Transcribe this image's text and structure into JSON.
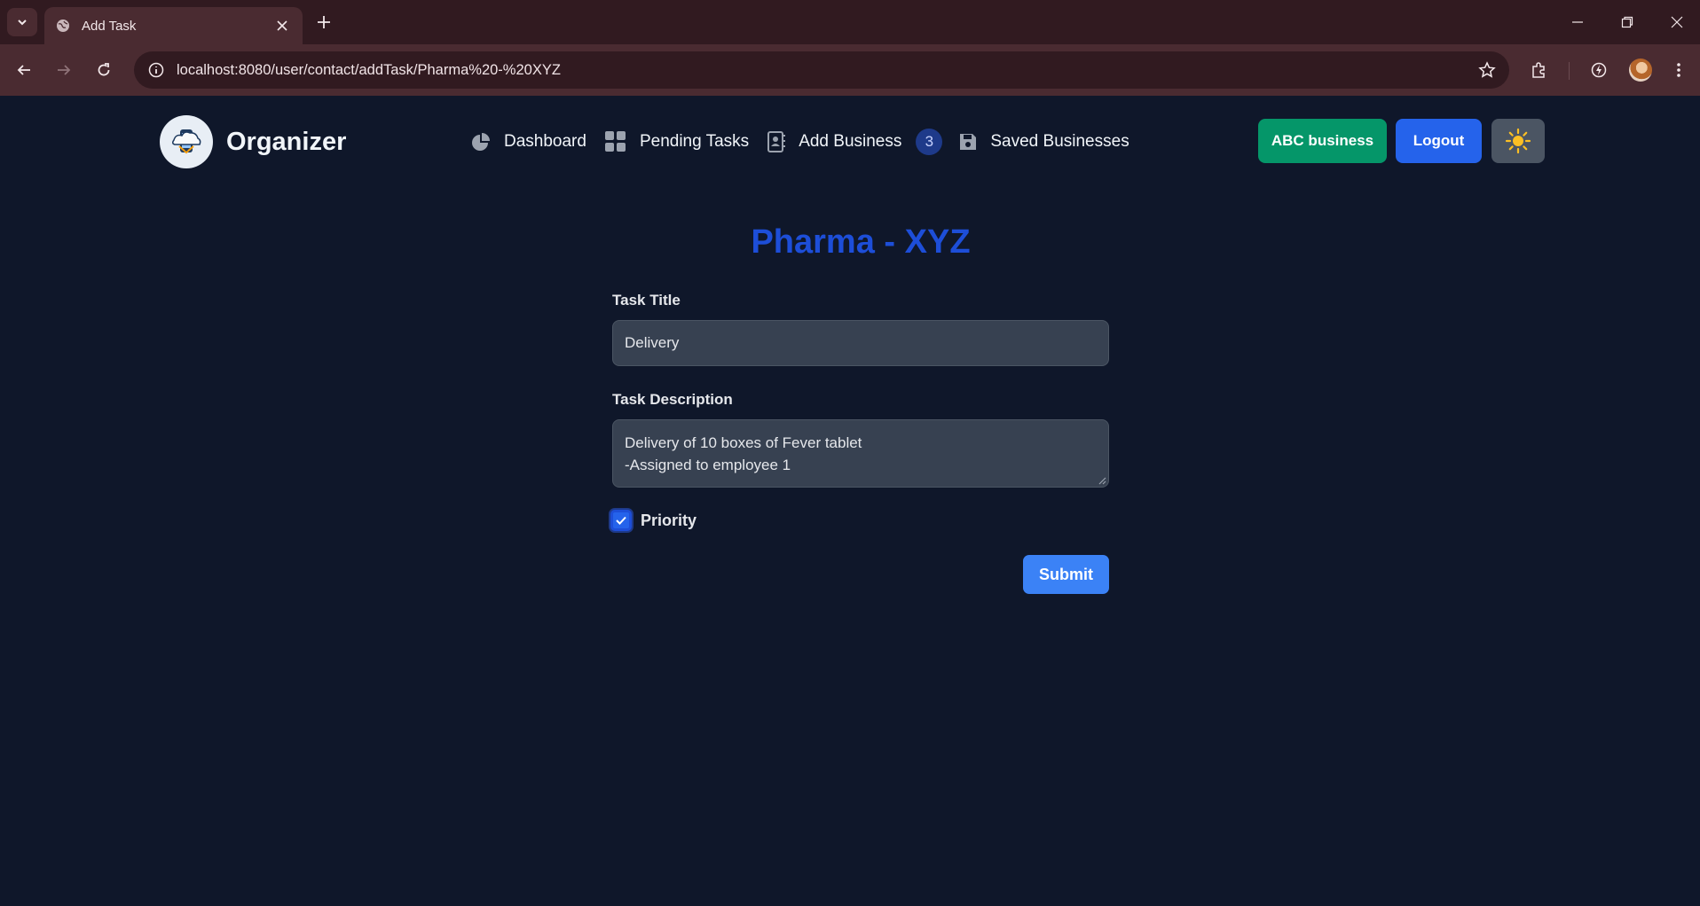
{
  "browser": {
    "tab_title": "Add Task",
    "url": "localhost:8080/user/contact/addTask/Pharma%20-%20XYZ"
  },
  "nav": {
    "brand": "Organizer",
    "menu": [
      {
        "label": "Dashboard",
        "icon": "pie-chart-icon"
      },
      {
        "label": "Pending Tasks",
        "icon": "grid-icon"
      },
      {
        "label": "Add Business",
        "icon": "contact-book-icon"
      },
      {
        "label": "Saved Businesses",
        "icon": "floppy-disk-icon"
      }
    ],
    "badge_count": "3",
    "business_button": "ABC business",
    "logout_button": "Logout",
    "theme_icon": "sun-icon"
  },
  "form": {
    "heading": "Pharma - XYZ",
    "title_label": "Task Title",
    "title_value": "Delivery",
    "description_label": "Task Description",
    "description_lines": [
      "Delivery of 10 boxes of Fever tablet",
      "-Assigned to employee 1"
    ],
    "priority_label": "Priority",
    "priority_checked": true,
    "submit_label": "Submit"
  },
  "colors": {
    "background": "#0f172a",
    "heading": "#1d4ed8",
    "business_btn": "#059669",
    "logout_btn": "#2563eb",
    "submit_btn": "#3b82f6"
  }
}
